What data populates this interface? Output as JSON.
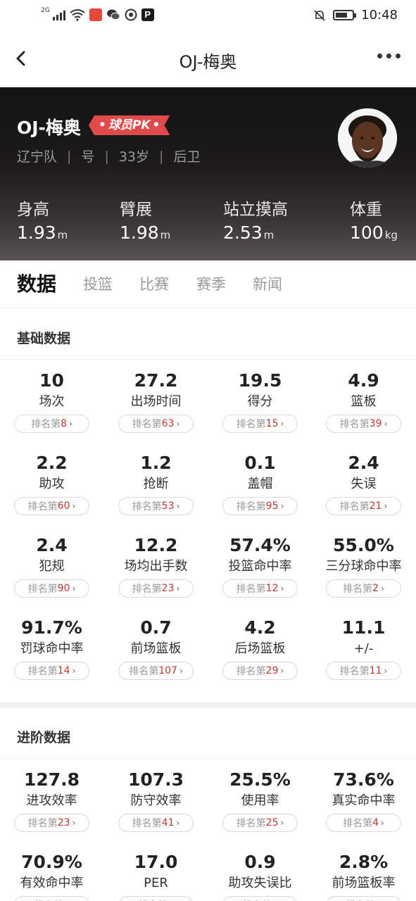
{
  "status_bar": {
    "network": "2G",
    "time": "10:48"
  },
  "nav": {
    "title": "OJ-梅奥"
  },
  "player": {
    "name": "OJ-梅奥",
    "pk_label": "球员PK",
    "team": "辽宁队",
    "number": "号",
    "age": "33岁",
    "position": "后卫",
    "metrics": [
      {
        "label": "身高",
        "value": "1.93",
        "unit": "m"
      },
      {
        "label": "臂展",
        "value": "1.98",
        "unit": "m"
      },
      {
        "label": "站立摸高",
        "value": "2.53",
        "unit": "m"
      },
      {
        "label": "体重",
        "value": "100",
        "unit": "kg"
      }
    ]
  },
  "tabs": [
    "数据",
    "投篮",
    "比赛",
    "赛季",
    "新闻"
  ],
  "rank_prefix": "排名第",
  "basic": {
    "title": "基础数据",
    "stats": [
      {
        "value": "10",
        "name": "场次",
        "rank": "8"
      },
      {
        "value": "27.2",
        "name": "出场时间",
        "rank": "63"
      },
      {
        "value": "19.5",
        "name": "得分",
        "rank": "15"
      },
      {
        "value": "4.9",
        "name": "篮板",
        "rank": "39"
      },
      {
        "value": "2.2",
        "name": "助攻",
        "rank": "60"
      },
      {
        "value": "1.2",
        "name": "抢断",
        "rank": "53"
      },
      {
        "value": "0.1",
        "name": "盖帽",
        "rank": "95"
      },
      {
        "value": "2.4",
        "name": "失误",
        "rank": "21"
      },
      {
        "value": "2.4",
        "name": "犯规",
        "rank": "90"
      },
      {
        "value": "12.2",
        "name": "场均出手数",
        "rank": "23"
      },
      {
        "value": "57.4%",
        "name": "投篮命中率",
        "rank": "12"
      },
      {
        "value": "55.0%",
        "name": "三分球命中率",
        "rank": "2"
      },
      {
        "value": "91.7%",
        "name": "罚球命中率",
        "rank": "14"
      },
      {
        "value": "0.7",
        "name": "前场篮板",
        "rank": "107"
      },
      {
        "value": "4.2",
        "name": "后场篮板",
        "rank": "29"
      },
      {
        "value": "11.1",
        "name": "+/-",
        "rank": "11"
      }
    ]
  },
  "advanced": {
    "title": "进阶数据",
    "stats": [
      {
        "value": "127.8",
        "name": "进攻效率",
        "rank": "23"
      },
      {
        "value": "107.3",
        "name": "防守效率",
        "rank": "41"
      },
      {
        "value": "25.5%",
        "name": "使用率",
        "rank": "25"
      },
      {
        "value": "73.6%",
        "name": "真实命中率",
        "rank": "4"
      },
      {
        "value": "70.9%",
        "name": "有效命中率",
        "rank": ""
      },
      {
        "value": "17.0",
        "name": "PER",
        "rank": ""
      },
      {
        "value": "0.9",
        "name": "助攻失误比",
        "rank": ""
      },
      {
        "value": "2.8%",
        "name": "前场篮板率",
        "rank": ""
      }
    ]
  },
  "colors": {
    "hero_dark": "#141414",
    "pk_red": "#e04a4a",
    "rank_red": "#c0392b"
  }
}
